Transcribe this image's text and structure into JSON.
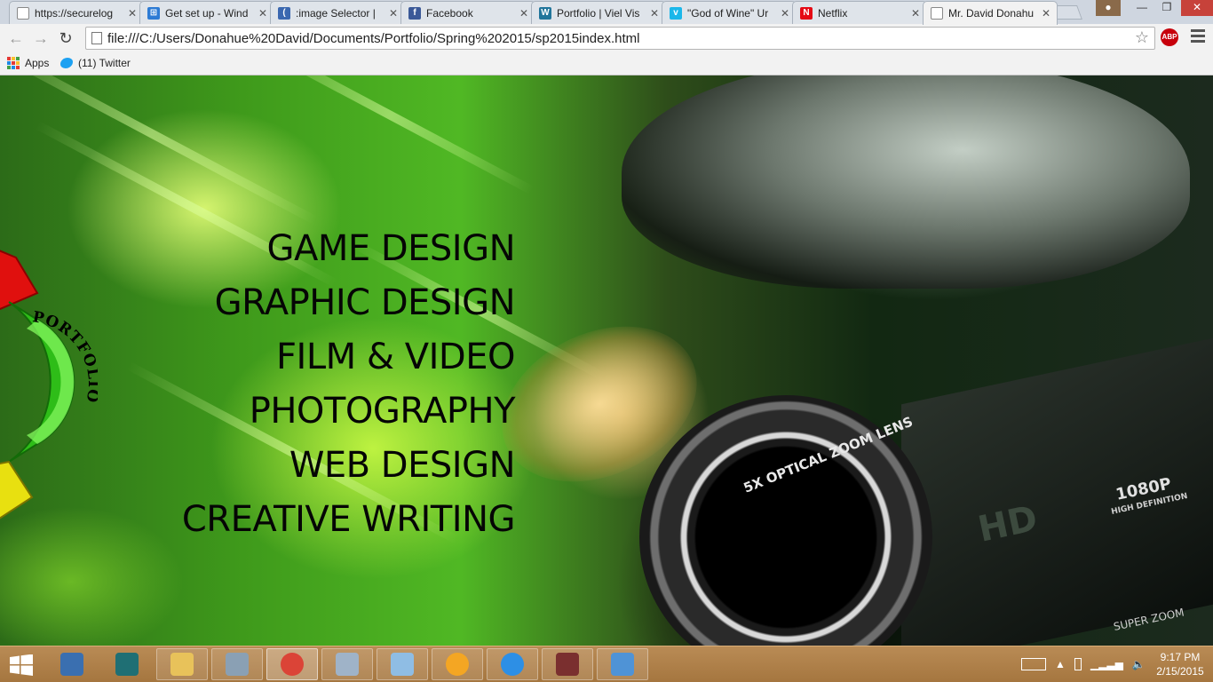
{
  "browser": {
    "tabs": [
      {
        "title": "https://securelog",
        "favicon": "generic-page-icon",
        "color": "#bfc6cf",
        "active": false
      },
      {
        "title": "Get set up - Wind",
        "favicon": "windows-logo-icon",
        "color": "#2d7bd4",
        "active": false
      },
      {
        "title": ":image Selector |",
        "favicon": "crescent-logo-icon",
        "color": "#3b68b0",
        "active": false
      },
      {
        "title": "Facebook",
        "favicon": "facebook-icon",
        "color": "#3b5998",
        "active": false
      },
      {
        "title": "Portfolio | Viel Vis",
        "favicon": "wordpress-icon",
        "color": "#21759b",
        "active": false
      },
      {
        "title": "\"God of Wine\" Ur",
        "favicon": "vimeo-icon",
        "color": "#1ab7ea",
        "active": false
      },
      {
        "title": "Netflix",
        "favicon": "netflix-icon",
        "color": "#e50914",
        "active": false
      },
      {
        "title": "Mr. David Donahu",
        "favicon": "generic-page-icon",
        "color": "#ffffff",
        "active": true
      }
    ],
    "url": "file:///C:/Users/Donahue%20David/Documents/Portfolio/Spring%202015/sp2015index.html",
    "bookmarks": {
      "apps_label": "Apps",
      "twitter_label": "(11) Twitter"
    },
    "extension_label": "ABP"
  },
  "page": {
    "nav": [
      {
        "label": "GAME DESIGN"
      },
      {
        "label": "GRAPHIC DESIGN"
      },
      {
        "label": "FILM & VIDEO"
      },
      {
        "label": "PHOTOGRAPHY"
      },
      {
        "label": "WEB DESIGN"
      },
      {
        "label": "CREATIVE WRITING"
      }
    ],
    "wheel_label": "PORTFOLIO",
    "lens_text": "5X OPTICAL ZOOM LENS",
    "camera_text": [
      "HD",
      "1080P",
      "HIGH DEFINITION",
      "SUPER ZOOM"
    ],
    "accent_colors": {
      "wheel_red": "#e0100e",
      "wheel_green": "#2ebd18",
      "wheel_yellow": "#e8e010"
    }
  },
  "taskbar": {
    "items": [
      {
        "name": "python-icon",
        "color": "#3a6fb0"
      },
      {
        "name": "3ds-max-icon",
        "color": "#1f6f74"
      },
      {
        "name": "file-explorer-icon",
        "color": "#e8c25a"
      },
      {
        "name": "network-icon",
        "color": "#8aa0b4"
      },
      {
        "name": "chrome-icon",
        "color": "#db4437"
      },
      {
        "name": "computer-icon",
        "color": "#9fb3c8"
      },
      {
        "name": "notepad-icon",
        "color": "#8fbde4"
      },
      {
        "name": "media-player-icon",
        "color": "#f4a623"
      },
      {
        "name": "itunes-icon",
        "color": "#2d8fe5"
      },
      {
        "name": "video-editor-icon",
        "color": "#7a2f2f"
      },
      {
        "name": "photo-viewer-icon",
        "color": "#4f93d6"
      }
    ],
    "time": "9:17 PM",
    "date": "2/15/2015"
  }
}
